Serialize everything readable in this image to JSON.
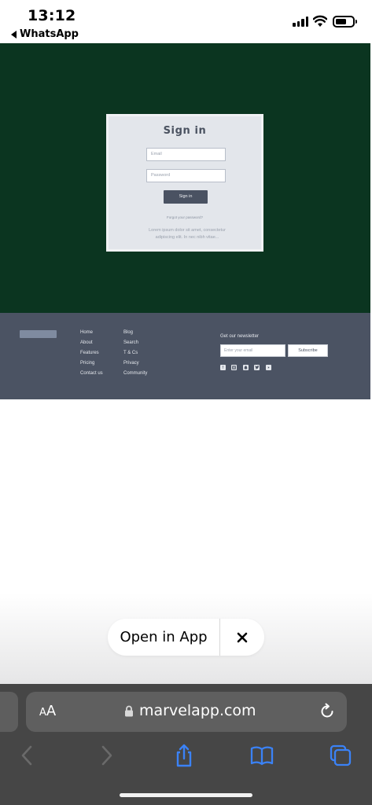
{
  "status_bar": {
    "time": "13:12",
    "back_app": "WhatsApp"
  },
  "signin": {
    "title": "Sign in",
    "email_placeholder": "Email",
    "password_placeholder": "Password",
    "button": "Sign in",
    "forgot": "Forgot your password?",
    "lorem": "Lorem ipsum dolor sit amet, consectetur adipiscing elit. In nec nibh vitae..."
  },
  "footer": {
    "col1": [
      "Home",
      "About",
      "Features",
      "Pricing",
      "Contact us"
    ],
    "col2": [
      "Blog",
      "Search",
      "T & Cs",
      "Privacy",
      "Community"
    ],
    "newsletter_title": "Get our newsletter",
    "newsletter_placeholder": "Enter your email",
    "subscribe": "Subscribe",
    "social": [
      "facebook-icon",
      "instagram-icon",
      "snapchat-icon",
      "twitter-icon",
      "youtube-icon"
    ]
  },
  "open_app": {
    "label": "Open in App"
  },
  "safari": {
    "aa_small": "A",
    "aa_big": "A",
    "url": "marvelapp.com"
  },
  "colors": {
    "hero_bg": "#0b3520",
    "footer_bg": "#4b5363",
    "safari_bar": "#464646",
    "accent_blue": "#3b82f6"
  }
}
